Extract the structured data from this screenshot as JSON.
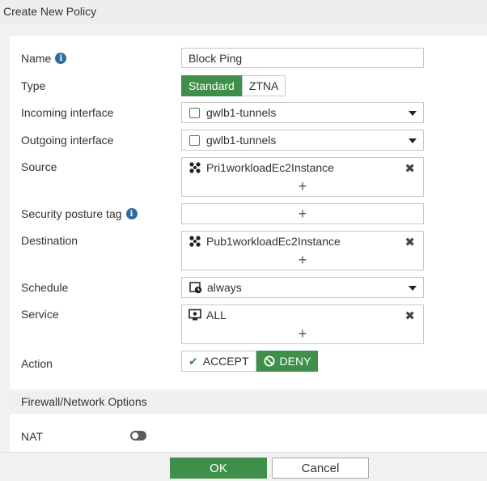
{
  "window": {
    "title": "Create New Policy"
  },
  "form": {
    "name": {
      "label": "Name",
      "value": "Block Ping",
      "info_icon": "i"
    },
    "type": {
      "label": "Type",
      "options": [
        "Standard",
        "ZTNA"
      ],
      "selected": "Standard"
    },
    "incoming_interface": {
      "label": "Incoming interface",
      "value": "gwlb1-tunnels"
    },
    "outgoing_interface": {
      "label": "Outgoing interface",
      "value": "gwlb1-tunnels"
    },
    "source": {
      "label": "Source",
      "value": "Pri1workloadEc2Instance",
      "add": "+",
      "remove": "✖"
    },
    "security_posture_tag": {
      "label": "Security posture tag",
      "info_icon": "i",
      "add": "+"
    },
    "destination": {
      "label": "Destination",
      "value": "Pub1workloadEc2Instance",
      "add": "+",
      "remove": "✖"
    },
    "schedule": {
      "label": "Schedule",
      "value": "always"
    },
    "service": {
      "label": "Service",
      "value": "ALL",
      "add": "+",
      "remove": "✖"
    },
    "action": {
      "label": "Action",
      "options": [
        "ACCEPT",
        "DENY"
      ],
      "selected": "DENY",
      "accept_glyph": "✔",
      "deny_glyph": "⃠"
    }
  },
  "section": {
    "title": "Firewall/Network Options"
  },
  "nat": {
    "label": "NAT",
    "enabled": false
  },
  "footer": {
    "ok_label": "OK",
    "cancel_label": "Cancel"
  },
  "colors": {
    "accent": "#3f8f4b",
    "info": "#2d6ca2"
  }
}
